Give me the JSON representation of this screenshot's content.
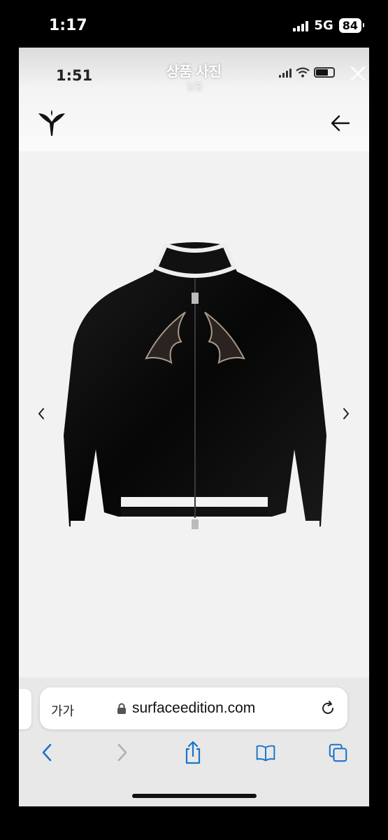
{
  "device_status": {
    "time": "1:17",
    "network": "5G",
    "battery": "84"
  },
  "inner_status": {
    "time": "1:51"
  },
  "viewer": {
    "title": "상품 사진",
    "counter": "1/3"
  },
  "browser": {
    "text_size_label": "가가",
    "url": "surfaceedition.com"
  },
  "icons": {
    "close": "close-icon",
    "logo": "brand-logo",
    "back": "arrow-left-icon",
    "prev": "chevron-left-icon",
    "next": "chevron-right-icon",
    "lock": "lock-icon",
    "reload": "reload-icon",
    "nav_back": "chevron-left-icon",
    "nav_forward": "chevron-right-icon",
    "share": "share-icon",
    "bookmarks": "book-icon",
    "tabs": "tabs-icon"
  },
  "colors": {
    "accent": "#1a73c9",
    "background": "#f2f2f2",
    "product": "#0a0a0a"
  }
}
